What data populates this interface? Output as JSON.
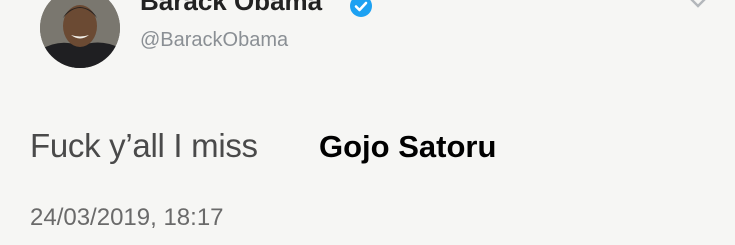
{
  "author": {
    "display_name": "Barack Obama",
    "handle": "@BarackObama",
    "verified_icon": "verified-badge-icon",
    "avatar": "profile-photo"
  },
  "menu_icon": "chevron-down-icon",
  "tweet": {
    "text": "Fuck y’all I miss",
    "overlay_text": "Gojo Satoru",
    "timestamp": "24/03/2019, 18:17"
  },
  "colors": {
    "background": "#f6f6f4",
    "verified_blue": "#1da1f2",
    "handle_gray": "#8a8f94",
    "text_gray": "#4a4a4a"
  }
}
